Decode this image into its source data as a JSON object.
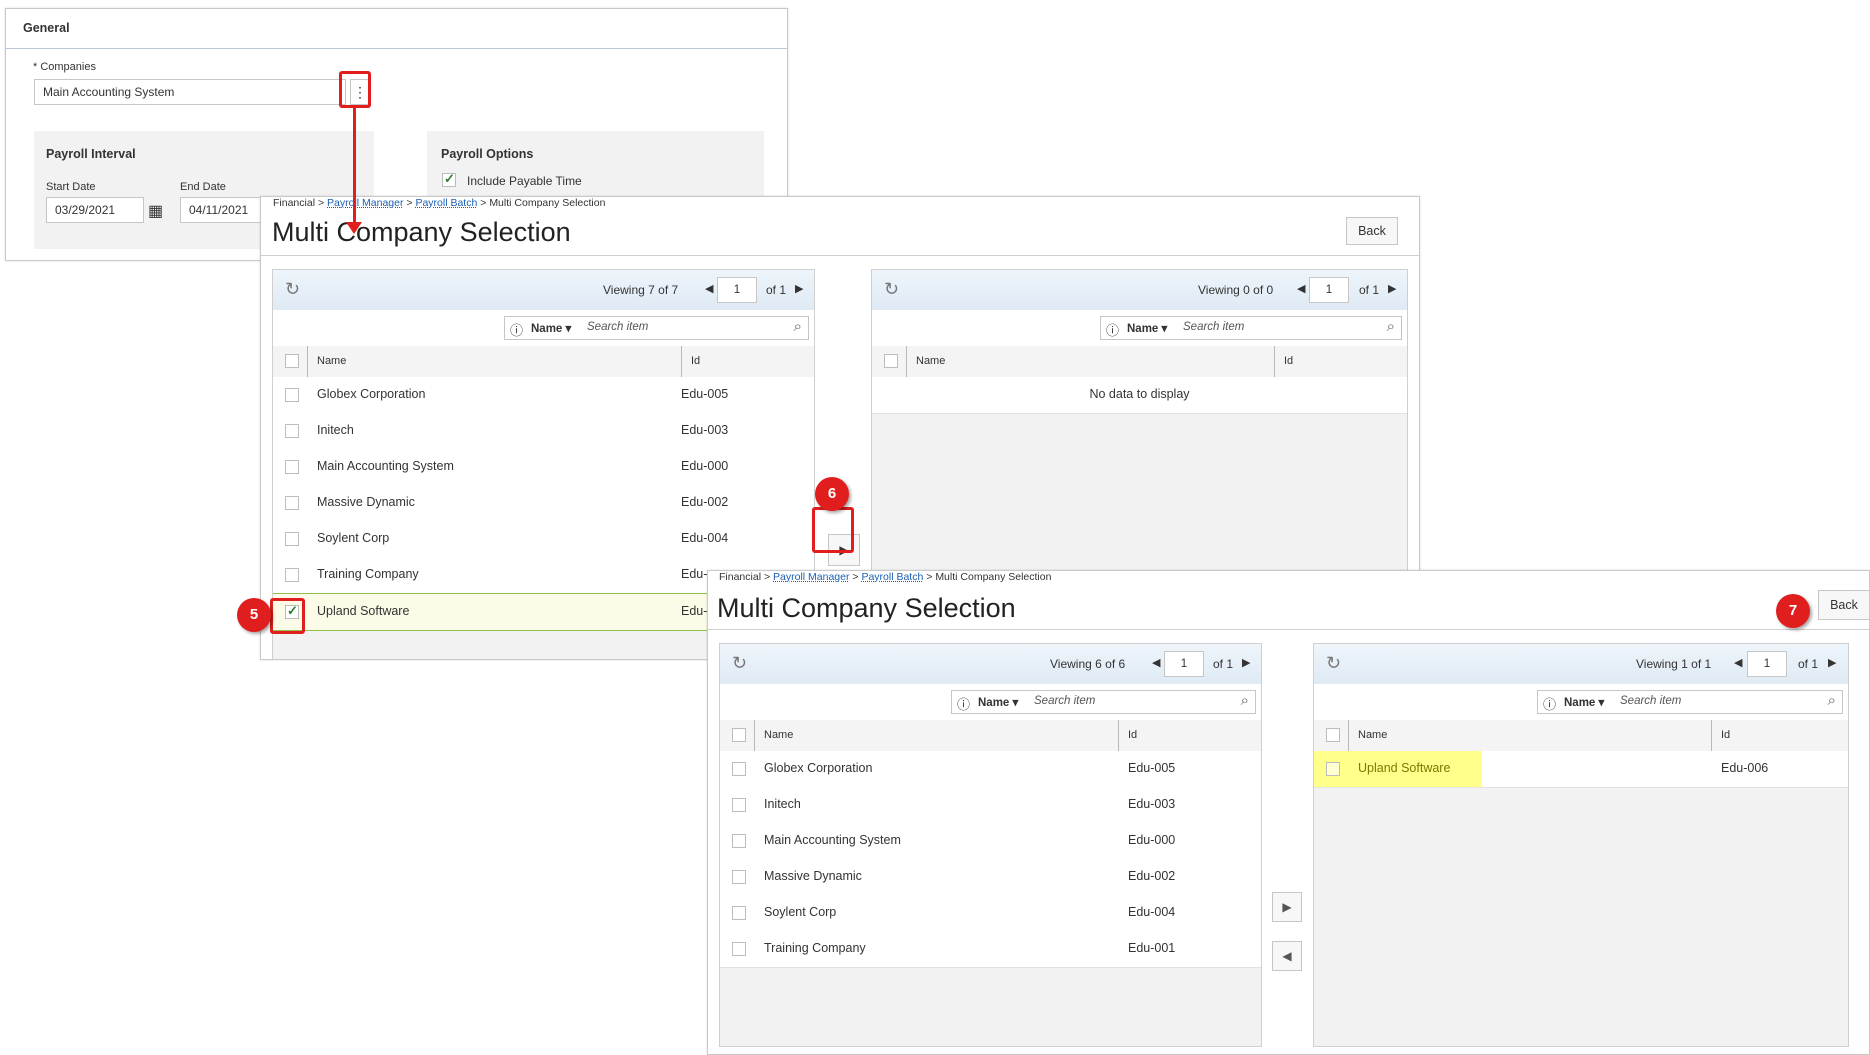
{
  "general": {
    "title": "General",
    "companies_label": "* Companies",
    "companies_value": "Main Accounting System",
    "payroll_interval": "Payroll Interval",
    "start_date_label": "Start Date",
    "start_date_value": "03/29/2021",
    "end_date_label": "End Date",
    "end_date_value": "04/11/2021",
    "payroll_options": "Payroll Options",
    "include_payable_time": "Include Payable Time"
  },
  "screen1": {
    "breadcrumb": {
      "financial": "Financial",
      "sep1": ">",
      "payroll_manager": "Payroll Manager",
      "sep2": ">",
      "payroll_batch": "Payroll Batch",
      "sep3": ">",
      "current": "Multi Company Selection"
    },
    "title": "Multi Company Selection",
    "back_label": "Back",
    "left_grid": {
      "viewing": "Viewing 7 of 7",
      "page": "1",
      "of": "of 1",
      "filter_label": "Name",
      "search_placeholder": "Search item",
      "col_name": "Name",
      "col_id": "Id",
      "rows": [
        {
          "name": "Globex Corporation",
          "id": "Edu-005"
        },
        {
          "name": "Initech",
          "id": "Edu-003"
        },
        {
          "name": "Main Accounting System",
          "id": "Edu-000"
        },
        {
          "name": "Massive Dynamic",
          "id": "Edu-002"
        },
        {
          "name": "Soylent Corp",
          "id": "Edu-004"
        },
        {
          "name": "Training Company",
          "id": "Edu-"
        },
        {
          "name": "Upland Software",
          "id": "Edu-"
        }
      ]
    },
    "right_grid": {
      "viewing": "Viewing 0 of 0",
      "page": "1",
      "of": "of 1",
      "filter_label": "Name",
      "search_placeholder": "Search item",
      "col_name": "Name",
      "col_id": "Id",
      "empty": "No data to display"
    }
  },
  "screen2": {
    "breadcrumb": {
      "financial": "Financial",
      "sep1": ">",
      "payroll_manager": "Payroll Manager",
      "sep2": ">",
      "payroll_batch": "Payroll Batch",
      "sep3": ">",
      "current": "Multi Company Selection"
    },
    "title": "Multi Company Selection",
    "back_label": "Back",
    "left_grid": {
      "viewing": "Viewing 6 of 6",
      "page": "1",
      "of": "of 1",
      "filter_label": "Name",
      "search_placeholder": "Search item",
      "col_name": "Name",
      "col_id": "Id",
      "rows": [
        {
          "name": "Globex Corporation",
          "id": "Edu-005"
        },
        {
          "name": "Initech",
          "id": "Edu-003"
        },
        {
          "name": "Main Accounting System",
          "id": "Edu-000"
        },
        {
          "name": "Massive Dynamic",
          "id": "Edu-002"
        },
        {
          "name": "Soylent Corp",
          "id": "Edu-004"
        },
        {
          "name": "Training Company",
          "id": "Edu-001"
        }
      ]
    },
    "right_grid": {
      "viewing": "Viewing 1 of 1",
      "page": "1",
      "of": "of 1",
      "filter_label": "Name",
      "search_placeholder": "Search item",
      "col_name": "Name",
      "col_id": "Id",
      "rows": [
        {
          "name": "Upland Software",
          "id": "Edu-006"
        }
      ]
    }
  },
  "callouts": {
    "step5": "5",
    "step6": "6",
    "step7": "7"
  },
  "colors": {
    "callout_red": "#e01e1e",
    "highlight_yellow": "#ffff8c",
    "link_blue": "#1a5fb4",
    "header_gradient": "#dfeaf4"
  }
}
